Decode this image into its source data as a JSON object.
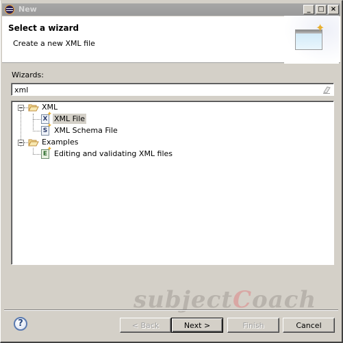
{
  "window": {
    "title": "New",
    "controls": {
      "minimize": "_",
      "maximize": "□",
      "close": "×"
    }
  },
  "header": {
    "title": "Select a wizard",
    "description": "Create a new XML file",
    "banner_icon": "new-wizard-banner-icon"
  },
  "wizards": {
    "label": "Wizards:",
    "filter_value": "xml",
    "filter_clear_icon": "eraser-icon"
  },
  "tree": {
    "items": [
      {
        "label": "XML",
        "type": "category",
        "expanded": true,
        "icon": "folder-open-icon",
        "children": [
          {
            "label": "XML File",
            "icon": "xml-file-icon",
            "icon_glyph": "X",
            "selected": true
          },
          {
            "label": "XML Schema File",
            "icon": "xml-schema-file-icon",
            "icon_glyph": "S",
            "selected": false
          }
        ]
      },
      {
        "label": "Examples",
        "type": "category",
        "expanded": true,
        "icon": "folder-open-icon",
        "children": [
          {
            "label": "Editing and validating XML files",
            "icon": "example-project-icon",
            "icon_glyph": "E",
            "selected": false
          }
        ]
      }
    ]
  },
  "watermark": {
    "part1": "subject",
    "part2": "C",
    "part3": "oach"
  },
  "footer": {
    "help_icon": "?",
    "buttons": {
      "back": {
        "label": "< Back",
        "enabled": false
      },
      "next": {
        "label": "Next >",
        "enabled": true,
        "default": true
      },
      "finish": {
        "label": "Finish",
        "enabled": false
      },
      "cancel": {
        "label": "Cancel",
        "enabled": true
      }
    }
  }
}
